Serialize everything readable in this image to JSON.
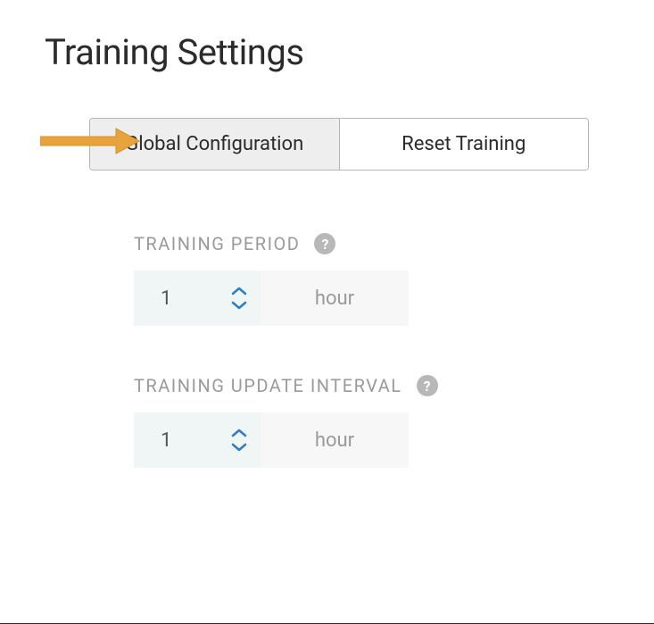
{
  "header": {
    "title": "Training Settings"
  },
  "tabs": {
    "global": "Global Configuration",
    "reset": "Reset Training"
  },
  "fields": {
    "period": {
      "label": "TRAINING PERIOD",
      "value": "1",
      "unit": "hour"
    },
    "interval": {
      "label": "TRAINING UPDATE INTERVAL",
      "value": "1",
      "unit": "hour"
    }
  },
  "icons": {
    "help": "?"
  }
}
